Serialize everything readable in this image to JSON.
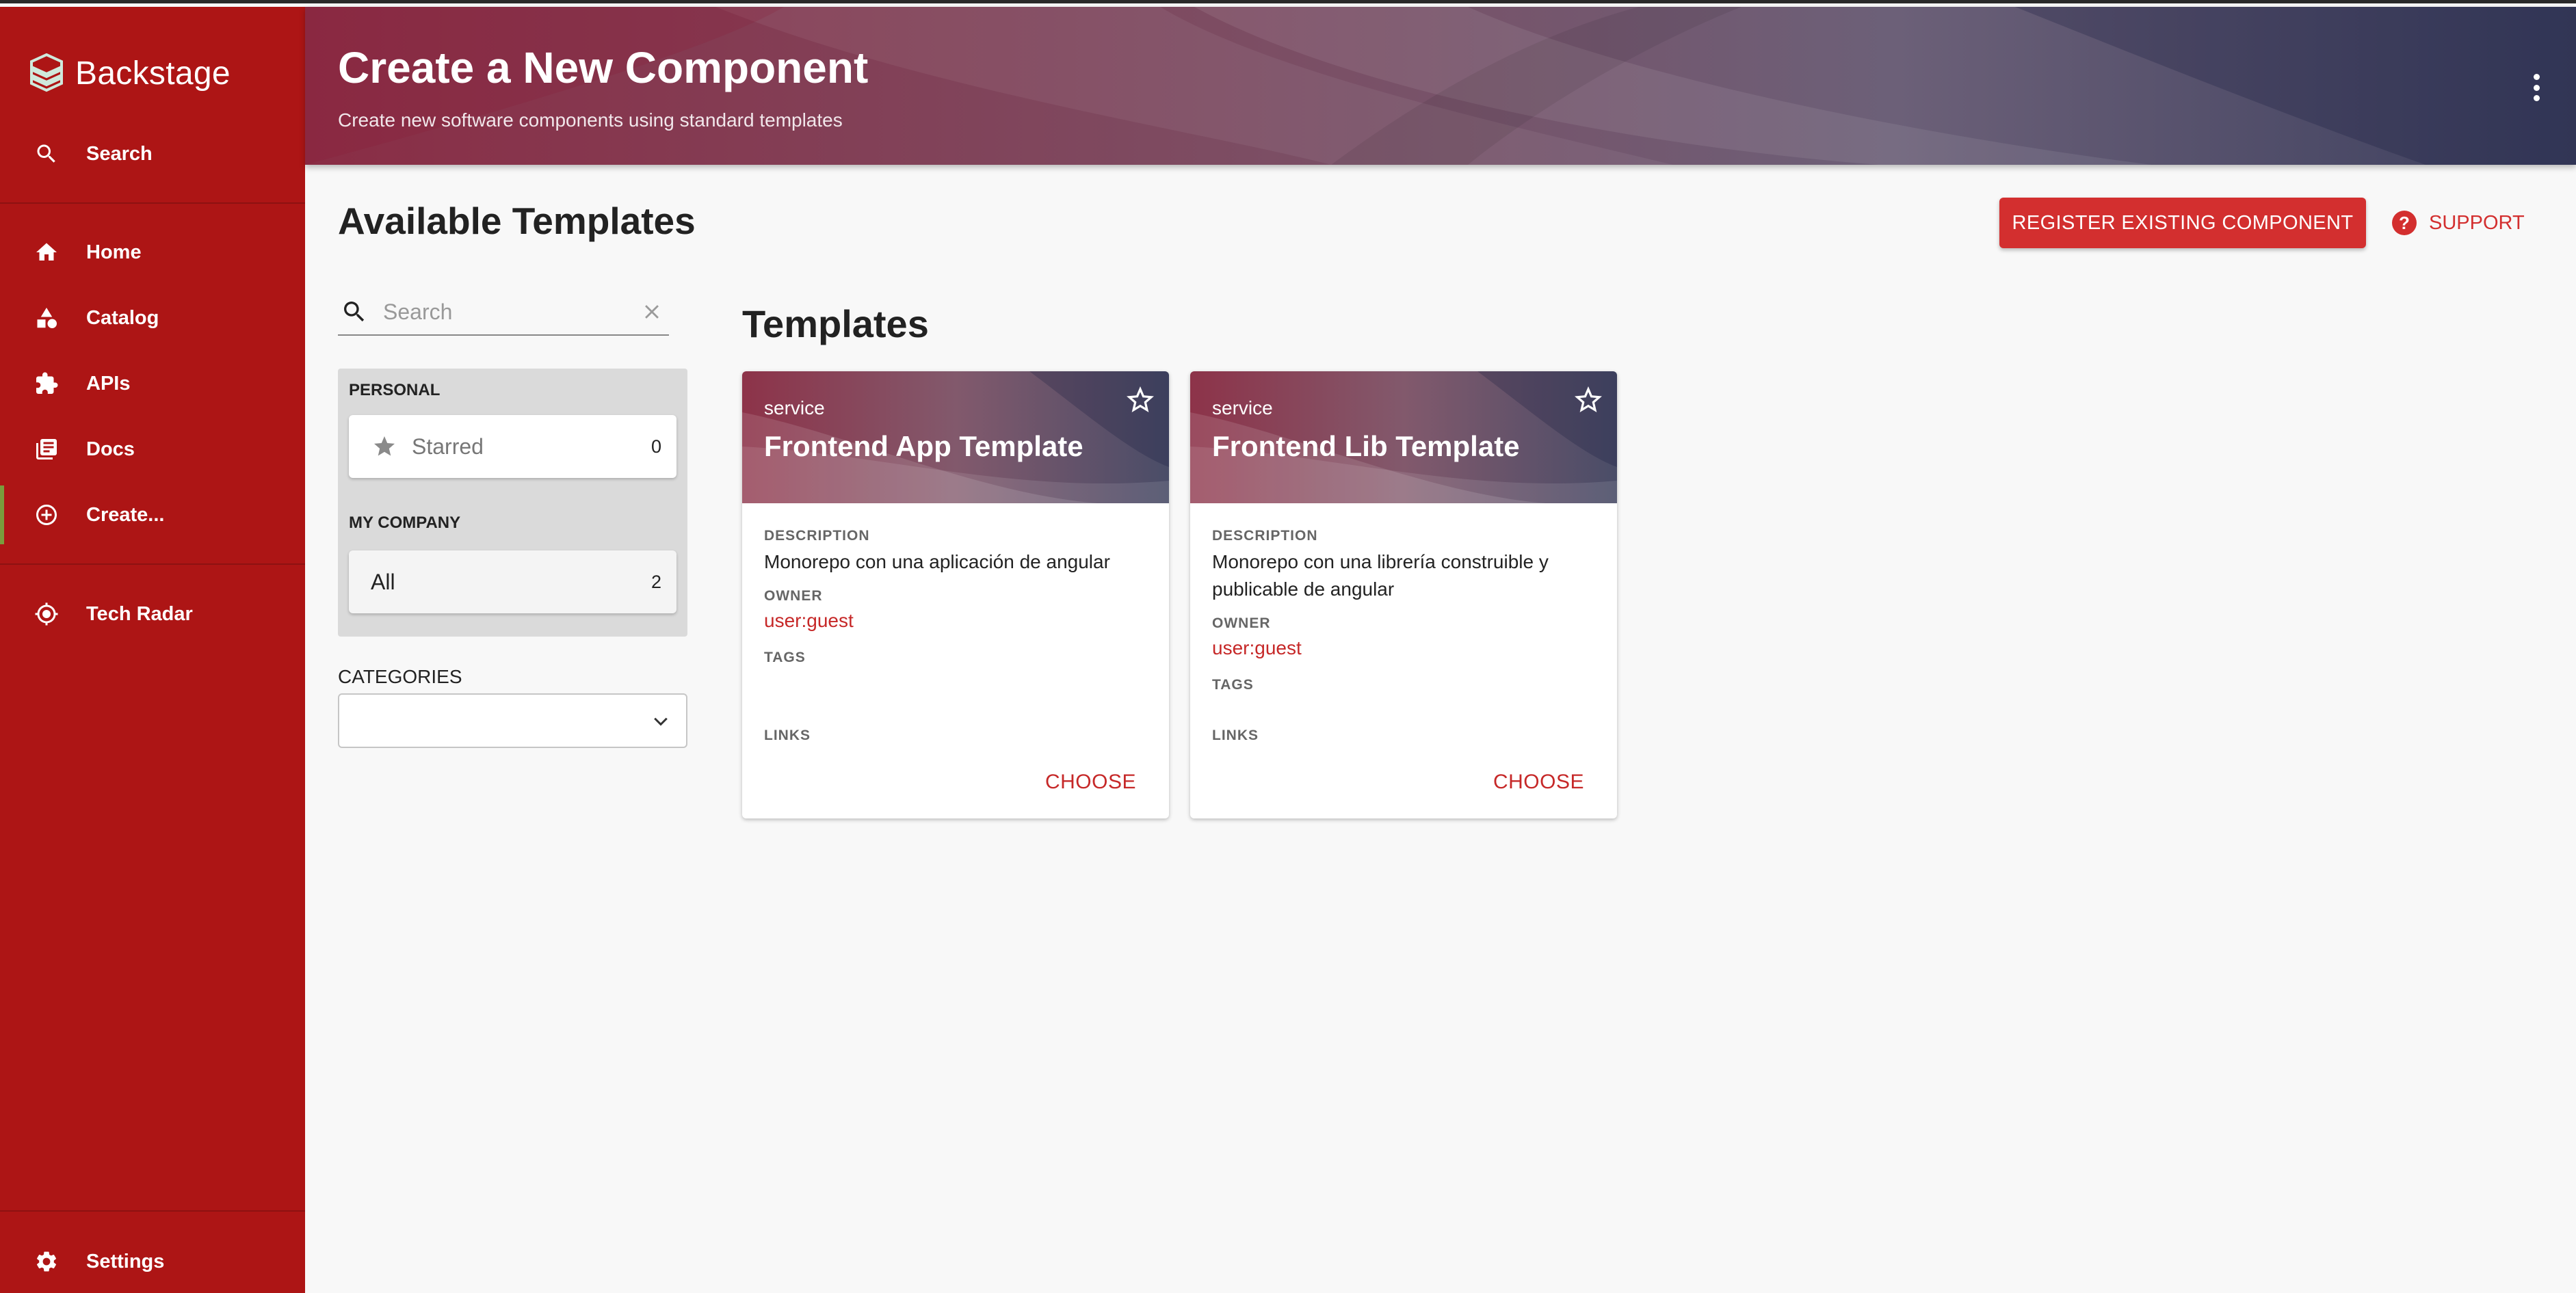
{
  "app": {
    "name": "Backstage"
  },
  "sidebar": {
    "search_label": "Search",
    "items": [
      {
        "label": "Home",
        "icon": "home-icon"
      },
      {
        "label": "Catalog",
        "icon": "catalog-icon"
      },
      {
        "label": "APIs",
        "icon": "puzzle-icon"
      },
      {
        "label": "Docs",
        "icon": "docs-icon"
      },
      {
        "label": "Create...",
        "icon": "add-circle-icon",
        "active": true
      }
    ],
    "tech_radar_label": "Tech Radar",
    "settings_label": "Settings"
  },
  "header": {
    "title": "Create a New Component",
    "subtitle": "Create new software components using standard templates"
  },
  "content": {
    "title": "Available Templates",
    "register_button": "REGISTER EXISTING COMPONENT",
    "support_label": "SUPPORT",
    "templates_heading": "Templates"
  },
  "filters": {
    "search_placeholder": "Search",
    "personal_heading": "PERSONAL",
    "starred_label": "Starred",
    "starred_count": "0",
    "company_heading": "MY COMPANY",
    "all_label": "All",
    "all_count": "2",
    "categories_label": "CATEGORIES",
    "categories_value": ""
  },
  "card_labels": {
    "description": "DESCRIPTION",
    "owner": "OWNER",
    "tags": "TAGS",
    "links": "LINKS",
    "choose": "CHOOSE"
  },
  "templates": [
    {
      "type": "service",
      "title": "Frontend App Template",
      "description": "Monorepo con una aplicación de angular",
      "owner": "user:guest"
    },
    {
      "type": "service",
      "title": "Frontend Lib Template",
      "description_line1": "Monorepo con una librería construible y",
      "description_line2": "publicable de angular",
      "owner": "user:guest"
    }
  ],
  "colors": {
    "sidebar": "#ad1515",
    "accent": "#d32f2f",
    "link": "#c62828"
  }
}
